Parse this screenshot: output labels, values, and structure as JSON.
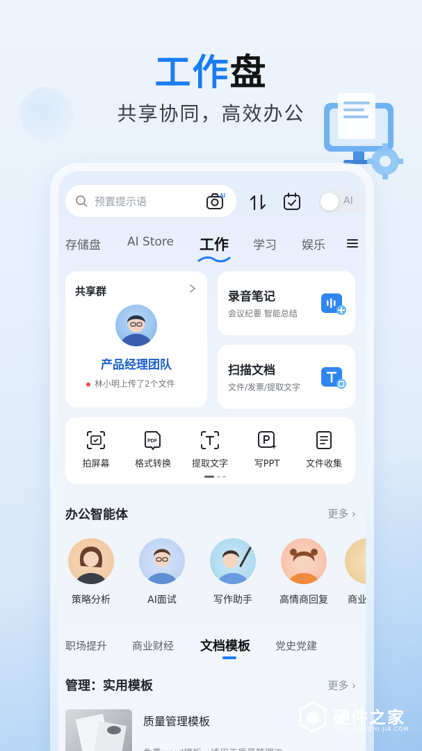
{
  "hero": {
    "title_blue": "工作",
    "title_dark": "盘",
    "subtitle": "共享协同，高效办公"
  },
  "search": {
    "placeholder": "预置提示语",
    "camera_badge": "AI"
  },
  "toggle": {
    "label": "AI",
    "on": false
  },
  "tabs": [
    {
      "label": "存储盘"
    },
    {
      "label": "AI Store"
    },
    {
      "label": "工作",
      "active": true
    },
    {
      "label": "学习"
    },
    {
      "label": "娱乐"
    }
  ],
  "share_card": {
    "title": "共享群",
    "group_name": "产品经理团队",
    "activity": "林小明上传了2个文件"
  },
  "feature_cards": [
    {
      "title": "录音笔记",
      "subtitle": "会议纪要  智能总结",
      "icon": "audio-note-icon"
    },
    {
      "title": "扫描文档",
      "subtitle": "文件/发票/提取文字",
      "icon": "scan-text-icon"
    }
  ],
  "tools": [
    {
      "label": "拍屏幕",
      "icon": "screen-capture-icon"
    },
    {
      "label": "格式转换",
      "icon": "pdf-convert-icon"
    },
    {
      "label": "提取文字",
      "icon": "extract-text-icon"
    },
    {
      "label": "写PPT",
      "icon": "ppt-icon"
    },
    {
      "label": "文件收集",
      "icon": "file-collect-icon"
    }
  ],
  "agents_section": {
    "title": "办公智能体",
    "more": "更多",
    "items": [
      {
        "label": "策略分析"
      },
      {
        "label": "AI面试"
      },
      {
        "label": "写作助手"
      },
      {
        "label": "高情商回复"
      },
      {
        "label": "商业"
      }
    ]
  },
  "subtabs": [
    {
      "label": "职场提升"
    },
    {
      "label": "商业财经"
    },
    {
      "label": "文档模板",
      "active": true
    },
    {
      "label": "党史党建"
    }
  ],
  "templates_section": {
    "title": "管理：实用模板",
    "more": "更多",
    "items": [
      {
        "title": "质量管理模板",
        "desc": "免费word模板，适用于质量管理工"
      }
    ]
  },
  "watermark": {
    "main": "硬件之家",
    "sub": "YING JIAN ZHI JIA.COM"
  },
  "colors": {
    "accent": "#1a7cf2",
    "dark_text": "#141414",
    "red_dot": "#f5484c"
  }
}
